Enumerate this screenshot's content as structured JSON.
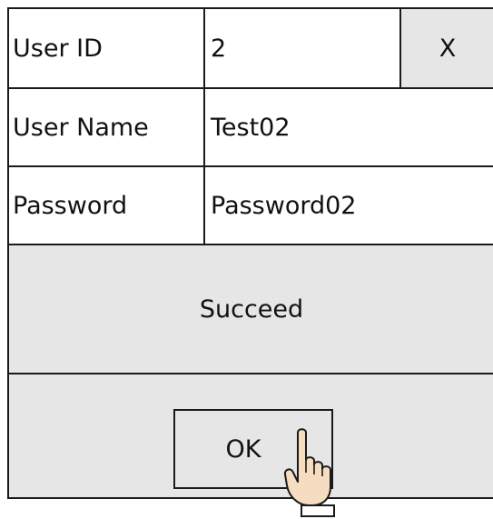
{
  "dialog": {
    "fields": {
      "user_id": {
        "label": "User ID",
        "value": "2"
      },
      "user_name": {
        "label": "User Name",
        "value": "Test02"
      },
      "password": {
        "label": "Password",
        "value": "Password02"
      }
    },
    "close_label": "X",
    "status_text": "Succeed",
    "ok_label": "OK"
  },
  "icons": {
    "pointer": "hand-pointer-icon"
  },
  "colors": {
    "panel_gray": "#e6e6e6",
    "border": "#1a1a1a",
    "hand_skin": "#f6dcc1"
  }
}
